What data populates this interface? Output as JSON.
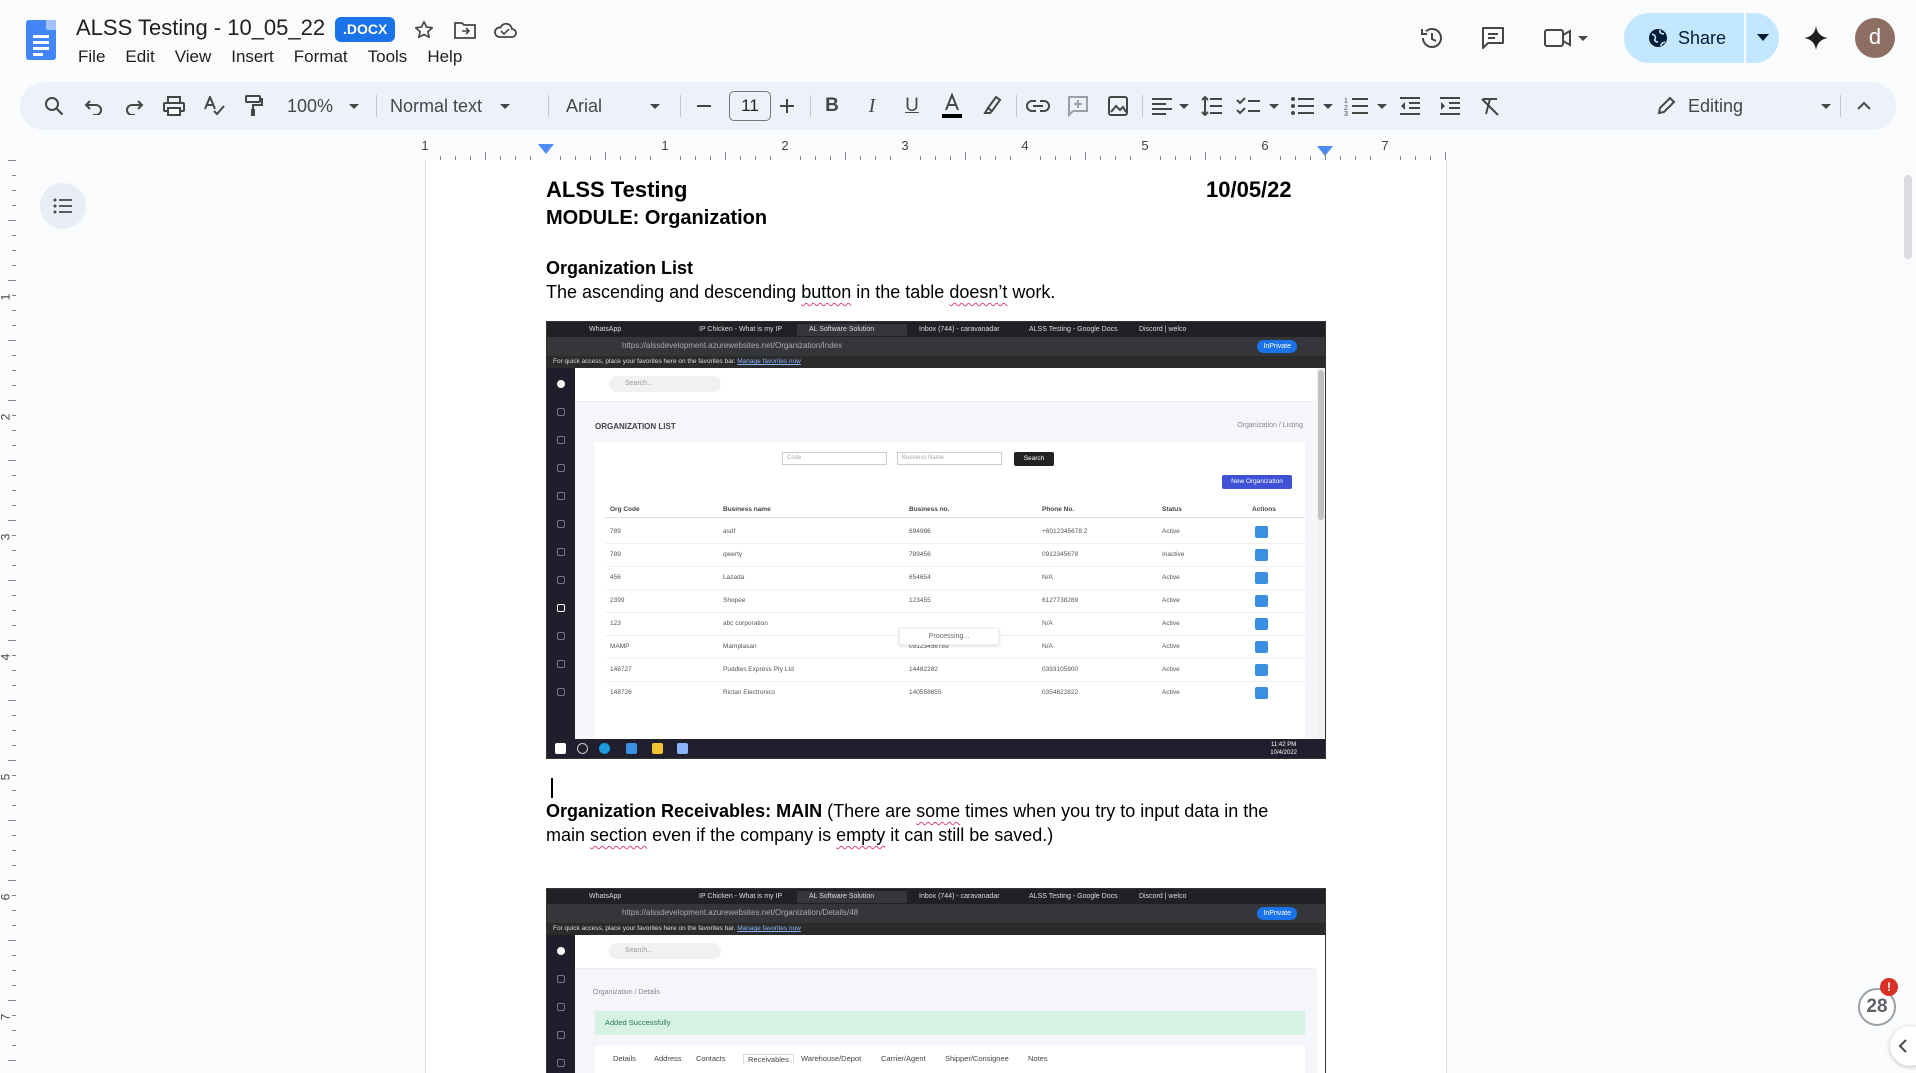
{
  "app": {
    "doc_title": "ALSS Testing - 10_05_22",
    "badge": ".DOCX",
    "menus": [
      "File",
      "Edit",
      "View",
      "Insert",
      "Format",
      "Tools",
      "Help"
    ],
    "share_label": "Share",
    "avatar_letter": "d",
    "brand_color": "#4285f4",
    "share_color": "#c2e7ff"
  },
  "toolbar": {
    "zoom": "100%",
    "style": "Normal text",
    "font": "Arial",
    "font_size": "11",
    "mode": "Editing"
  },
  "ruler": {
    "h_numbers": [
      "1",
      "1",
      "2",
      "3",
      "4",
      "5",
      "6",
      "7"
    ],
    "v_numbers": [
      "1",
      "2",
      "3",
      "4",
      "5",
      "6",
      "7"
    ]
  },
  "document": {
    "title": "ALSS Testing",
    "date": "10/05/22",
    "module": "MODULE: Organization",
    "section1_heading": "Organization List",
    "section1_body_a": "The ascending and descending ",
    "section1_body_b": "button",
    "section1_body_c": " in the table ",
    "section1_body_d": "doesn’t",
    "section1_body_e": " work.",
    "section2_heading": "Organization Receivables: MAIN",
    "section2_line1_a": " (There are ",
    "section2_line1_b": "some",
    "section2_line1_c": " times when you try to input data in the",
    "section2_line2_a": "main ",
    "section2_line2_b": "section",
    "section2_line2_c": " even if the company is ",
    "section2_line2_d": "empty",
    "section2_line2_e": " it can still be saved.)"
  },
  "screenshot1": {
    "tabs": [
      "WhatsApp",
      "IP Chicken - What is my IP",
      "AL Software Solution",
      "Inbox (744) - caravanadar",
      "ALSS Testing - Google Docs",
      "Discord | welco"
    ],
    "url": "https://alssdevelopment.azurewebsites.net/Organization/Index",
    "inprivate": "InPrivate",
    "fav_text": "For quick access, place your favorites here on the favorites bar.",
    "fav_link": "Manage favorites now",
    "search_placeholder": "Search...",
    "page_title": "ORGANIZATION LIST",
    "breadcrumb": "Organization  /  Listing",
    "code_placeholder": "Code",
    "business_placeholder": "Business Name",
    "search_btn": "Search",
    "new_btn": "New Organization",
    "columns": [
      "Org Code",
      "Business name",
      "Business no.",
      "Phone No.",
      "Status",
      "Actions"
    ],
    "rows": [
      [
        "789",
        "asdf",
        "694986",
        "+6012345678 2",
        "Active"
      ],
      [
        "789",
        "qwerty",
        "789456",
        "0912345678",
        "Inactive"
      ],
      [
        "456",
        "Lazada",
        "654654",
        "N/A",
        "Active"
      ],
      [
        "2399",
        "Shopee",
        "123455",
        "6127738289",
        "Active"
      ],
      [
        "123",
        "abc corporation",
        "",
        "N/A",
        "Active"
      ],
      [
        "MAMP",
        "Mamplasan",
        "09123456789",
        "N/A",
        "Active"
      ],
      [
        "148727",
        "Puddles Express Pty Ltd",
        "14482282",
        "0393105900",
        "Active"
      ],
      [
        "148726",
        "Rictan Electronics",
        "140558655",
        "0354822822",
        "Active"
      ]
    ],
    "processing": "Processing...",
    "clock_time": "11:42 PM",
    "clock_date": "10/4/2022"
  },
  "screenshot2": {
    "url": "https://alssdevelopment.azurewebsites.net/Organization/Details/48",
    "breadcrumb": "Organization  /  Details",
    "alert": "Added Successfully",
    "tabs": [
      "Details",
      "Address",
      "Contacts",
      "Receivables",
      "Warehouse/Depot",
      "Carrier/Agent",
      "Shipper/Consignee",
      "Notes"
    ]
  },
  "notifications": {
    "count": "28",
    "badge": "!"
  }
}
